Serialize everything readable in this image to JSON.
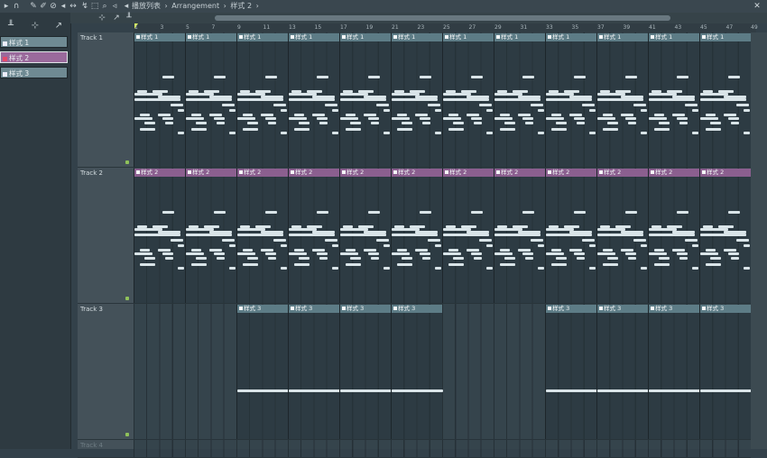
{
  "toolbar": {
    "icons": [
      "magnet-icon",
      "paint-icon",
      "pencil-icon",
      "select-icon",
      "mute-icon",
      "speaker-icon",
      "slip-icon",
      "slice-icon",
      "zoom-icon",
      "playback-icon"
    ],
    "breadcrumb": [
      "播放列表",
      "Arrangement",
      "样式 2"
    ],
    "separator": "›",
    "close": "✕"
  },
  "colors": {
    "pattern1": "#5d7c86",
    "pattern2": "#8b5f8f",
    "pattern3": "#5d7c86",
    "track_dot": "#8fc15a",
    "grid_bg": "#35444c"
  },
  "left_panel": {
    "tools": [
      "piano-icon",
      "snap-icon",
      "slide-icon"
    ],
    "patterns": [
      {
        "label": "样式 1",
        "color": "#6f8a93",
        "selected": false
      },
      {
        "label": "样式 2",
        "color": "#9a6a9c",
        "selected": true
      },
      {
        "label": "样式 3",
        "color": "#6f8a93",
        "selected": false
      }
    ]
  },
  "ruler": {
    "bars": [
      "1",
      "3",
      "5",
      "7",
      "9",
      "11",
      "13",
      "15",
      "17",
      "19",
      "21",
      "23",
      "25",
      "27",
      "29",
      "31",
      "33",
      "35",
      "37",
      "39",
      "41",
      "43",
      "45",
      "47",
      "49"
    ]
  },
  "tracks": [
    {
      "name": "Track 1",
      "pattern": "样式 1",
      "clips": [
        1,
        5,
        9,
        13,
        17,
        21,
        25,
        29,
        33,
        37,
        41,
        45
      ]
    },
    {
      "name": "Track 2",
      "pattern": "样式 2",
      "clips": [
        1,
        5,
        9,
        13,
        17,
        21,
        25,
        29,
        33,
        37,
        41,
        45
      ]
    },
    {
      "name": "Track 3",
      "pattern": "样式 3",
      "clips": [
        9,
        13,
        17,
        21,
        33,
        37,
        41,
        45
      ]
    },
    {
      "name": "Track 4",
      "pattern": "",
      "clips": []
    }
  ]
}
